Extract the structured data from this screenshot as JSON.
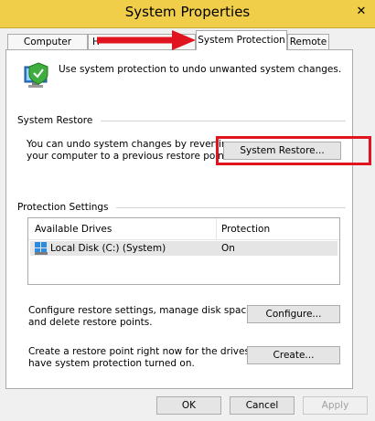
{
  "window": {
    "title": "System Properties",
    "close_symbol": "✕"
  },
  "tabs": [
    {
      "label": "Computer Name",
      "active": false
    },
    {
      "label": "H",
      "active": false
    },
    {
      "label": "System Protection",
      "active": true
    },
    {
      "label": "Remote",
      "active": false
    }
  ],
  "intro": {
    "text": "Use system protection to undo unwanted system changes."
  },
  "system_restore": {
    "group_label": "System Restore",
    "description_line1": "You can undo system changes by reverting",
    "description_line2": "your computer to a previous restore point.",
    "button_label": "System Restore..."
  },
  "protection_settings": {
    "group_label": "Protection Settings",
    "columns": [
      "Available Drives",
      "Protection"
    ],
    "rows": [
      {
        "drive": "Local Disk (C:) (System)",
        "protection": "On"
      }
    ],
    "configure_text_line1": "Configure restore settings, manage disk space,",
    "configure_text_line2": "and delete restore points.",
    "configure_button": "Configure...",
    "create_text_line1": "Create a restore point right now for the drives that",
    "create_text_line2": "have system protection turned on.",
    "create_button": "Create..."
  },
  "footer": {
    "ok": "OK",
    "cancel": "Cancel",
    "apply": "Apply"
  },
  "colors": {
    "titlebar": "#F0CE49",
    "highlight": "#E0141E",
    "arrow": "#E0141E"
  }
}
